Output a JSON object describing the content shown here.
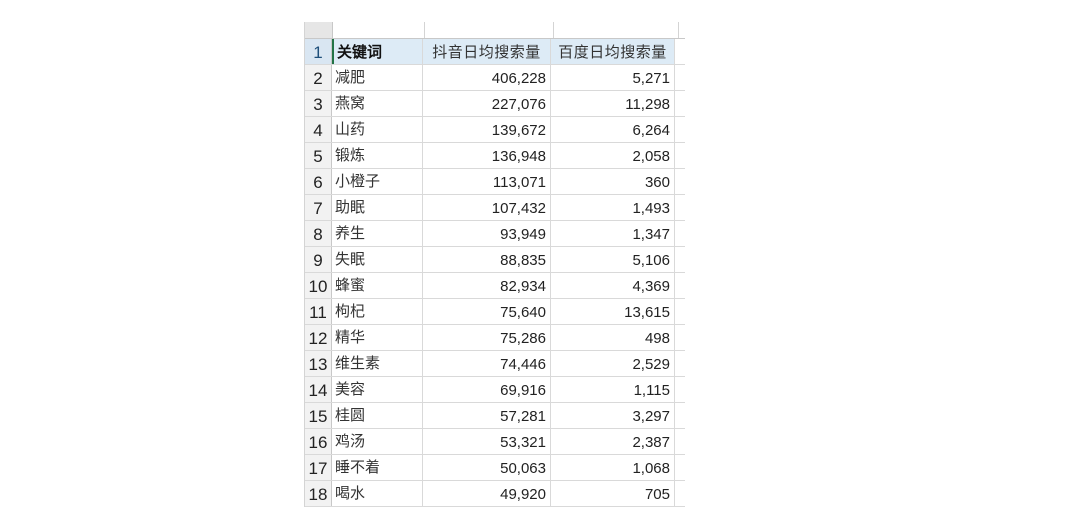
{
  "header": {
    "row_number": "1",
    "keyword_label": "关键词",
    "douyin_label": "抖音日均搜索量",
    "baidu_label": "百度日均搜索量"
  },
  "rows": [
    {
      "n": "2",
      "keyword": "减肥",
      "douyin": "406,228",
      "baidu": "5,271"
    },
    {
      "n": "3",
      "keyword": "燕窝",
      "douyin": "227,076",
      "baidu": "11,298"
    },
    {
      "n": "4",
      "keyword": "山药",
      "douyin": "139,672",
      "baidu": "6,264"
    },
    {
      "n": "5",
      "keyword": "锻炼",
      "douyin": "136,948",
      "baidu": "2,058"
    },
    {
      "n": "6",
      "keyword": "小橙子",
      "douyin": "113,071",
      "baidu": "360"
    },
    {
      "n": "7",
      "keyword": "助眠",
      "douyin": "107,432",
      "baidu": "1,493"
    },
    {
      "n": "8",
      "keyword": "养生",
      "douyin": "93,949",
      "baidu": "1,347"
    },
    {
      "n": "9",
      "keyword": "失眠",
      "douyin": "88,835",
      "baidu": "5,106"
    },
    {
      "n": "10",
      "keyword": "蜂蜜",
      "douyin": "82,934",
      "baidu": "4,369"
    },
    {
      "n": "11",
      "keyword": "枸杞",
      "douyin": "75,640",
      "baidu": "13,615"
    },
    {
      "n": "12",
      "keyword": "精华",
      "douyin": "75,286",
      "baidu": "498"
    },
    {
      "n": "13",
      "keyword": "维生素",
      "douyin": "74,446",
      "baidu": "2,529"
    },
    {
      "n": "14",
      "keyword": "美容",
      "douyin": "69,916",
      "baidu": "1,115"
    },
    {
      "n": "15",
      "keyword": "桂圆",
      "douyin": "57,281",
      "baidu": "3,297"
    },
    {
      "n": "16",
      "keyword": "鸡汤",
      "douyin": "53,321",
      "baidu": "2,387"
    },
    {
      "n": "17",
      "keyword": "睡不着",
      "douyin": "50,063",
      "baidu": "1,068"
    },
    {
      "n": "18",
      "keyword": "喝水",
      "douyin": "49,920",
      "baidu": "705"
    }
  ],
  "colors": {
    "header_fill": "#ddebf6",
    "active_row_header": "#d9e6f2",
    "active_cell_border": "#217346"
  }
}
